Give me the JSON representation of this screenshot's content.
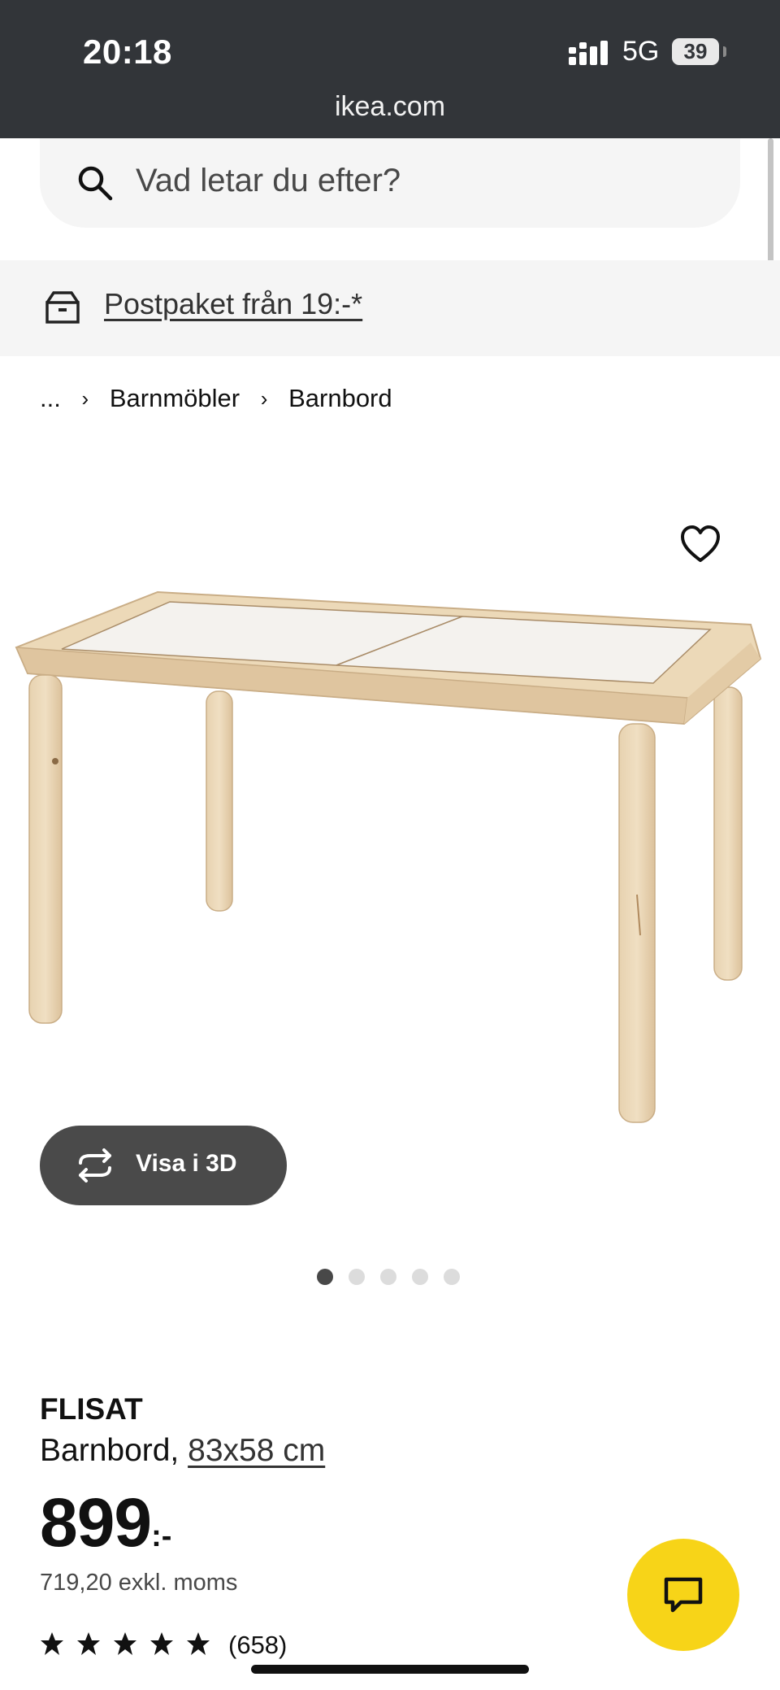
{
  "status_bar": {
    "time": "20:18",
    "network": "5G",
    "battery": "39",
    "url": "ikea.com"
  },
  "search": {
    "placeholder": "Vad letar du efter?"
  },
  "promo": {
    "link": "Postpaket från 19:-*"
  },
  "breadcrumb": {
    "ellipsis": "...",
    "items": [
      "Barnmöbler",
      "Barnbord"
    ]
  },
  "gallery": {
    "view3d_label": "Visa i 3D",
    "slide_count": 5,
    "active_slide": 1
  },
  "product": {
    "name": "FLISAT",
    "description": "Barnbord,",
    "dimensions": "83x58 cm",
    "price": "899",
    "price_suffix": ":-",
    "price_excl_vat": "719,20 exkl. moms",
    "rating": 5,
    "review_count": "(658)"
  },
  "colors": {
    "status_bar_bg": "#323539",
    "chat_button": "#f7d418",
    "view3d_button": "#4a4a4a"
  },
  "icons": [
    "search-icon",
    "delivery-box-icon",
    "chevron-right-icon",
    "heart-icon",
    "rotate-3d-icon",
    "star-icon",
    "chat-icon"
  ]
}
